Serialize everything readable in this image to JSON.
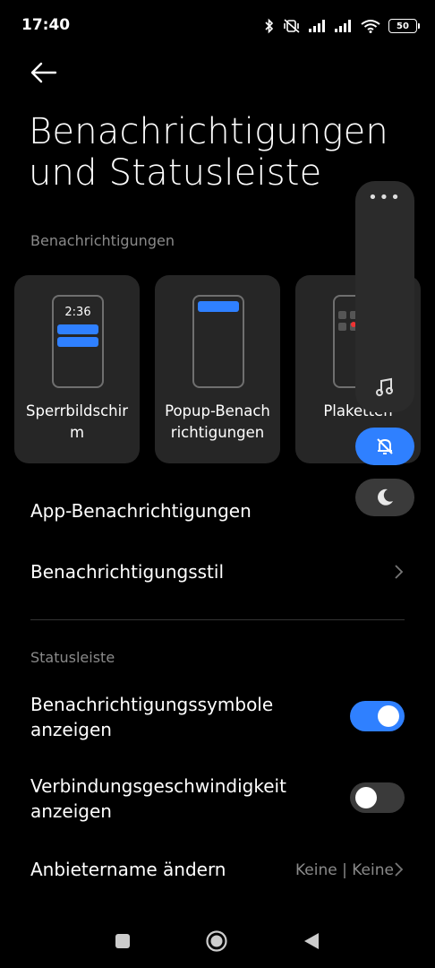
{
  "status_bar": {
    "time": "17:40",
    "battery": "50"
  },
  "header": {
    "title_line1": "Benachrichtigungen",
    "title_line2": "und Statusleiste"
  },
  "notifications_section": {
    "label": "Benachrichtigungen",
    "cards": [
      {
        "line1": "Sperrbildschir",
        "line2": "m",
        "clock": "2:36"
      },
      {
        "line1": "Popup-Benach",
        "line2": "richtigungen"
      },
      {
        "line1": "Plaketten",
        "line2": ""
      }
    ],
    "items": [
      {
        "label": "App-Benachrichtigungen"
      },
      {
        "label": "Benachrichtigungsstil"
      }
    ]
  },
  "statusbar_section": {
    "label": "Statusleiste",
    "items": [
      {
        "line1": "Benachrichtigungssymbole",
        "line2": "anzeigen",
        "enabled": true
      },
      {
        "line1": "Verbindungsgeschwindigkeit",
        "line2": "anzeigen",
        "enabled": false
      },
      {
        "label": "Anbietername ändern",
        "value": "Keine | Keine"
      }
    ]
  },
  "volume_panel": {
    "more_label": "•••",
    "icons": [
      "music-note-icon",
      "bell-off-icon",
      "moon-icon"
    ],
    "accent": "#2f80ff"
  },
  "colors": {
    "background": "#000000",
    "accent": "#2f80ff",
    "card": "#262626",
    "secondary_text": "#8a8a8a"
  }
}
